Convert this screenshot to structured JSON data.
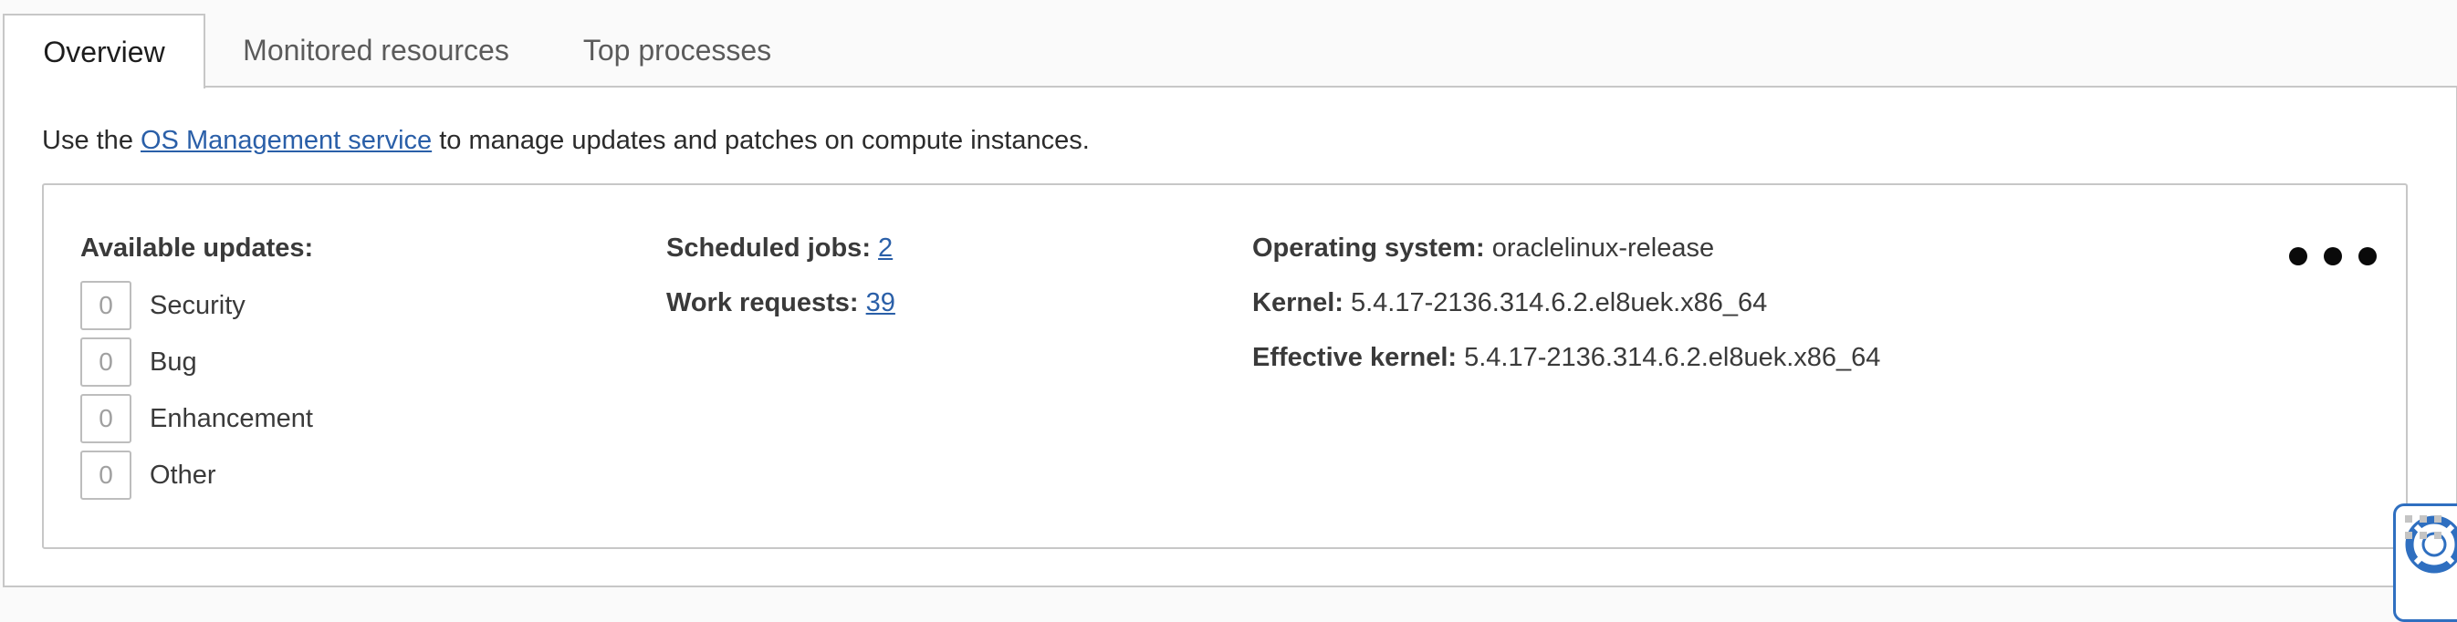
{
  "tabs": [
    {
      "label": "Overview",
      "active": true
    },
    {
      "label": "Monitored resources",
      "active": false
    },
    {
      "label": "Top processes",
      "active": false
    }
  ],
  "intro": {
    "prefix": "Use the ",
    "link": "OS Management service",
    "suffix": " to manage updates and patches on compute instances."
  },
  "updates": {
    "heading": "Available updates:",
    "items": [
      {
        "count": "0",
        "label": "Security"
      },
      {
        "count": "0",
        "label": "Bug"
      },
      {
        "count": "0",
        "label": "Enhancement"
      },
      {
        "count": "0",
        "label": "Other"
      }
    ]
  },
  "jobs": {
    "scheduled_label": "Scheduled jobs:",
    "scheduled_value": "2",
    "work_label": "Work requests:",
    "work_value": "39"
  },
  "system": {
    "os_label": "Operating system:",
    "os_value": "oraclelinux-release",
    "kernel_label": "Kernel:",
    "kernel_value": "5.4.17-2136.314.6.2.el8uek.x86_64",
    "eff_kernel_label": "Effective kernel:",
    "eff_kernel_value": "5.4.17-2136.314.6.2.el8uek.x86_64"
  },
  "icons": {
    "more": "more-actions-icon",
    "help": "help-lifebuoy-icon",
    "grip": "drag-grip-icon"
  },
  "colors": {
    "link": "#2a5fa8",
    "help_border": "#2f6fc0"
  }
}
